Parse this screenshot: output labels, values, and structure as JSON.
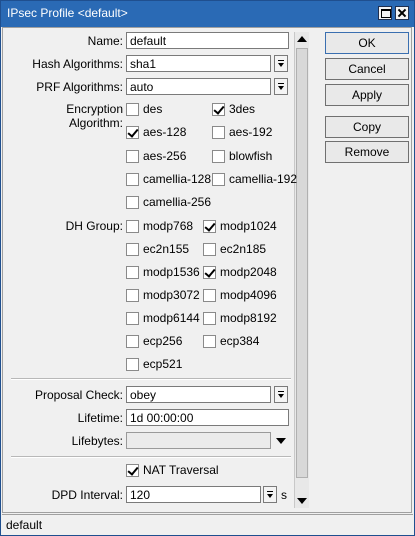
{
  "window": {
    "title": "IPsec Profile <default>"
  },
  "form": {
    "name_label": "Name:",
    "name_value": "default",
    "hash_label": "Hash Algorithms:",
    "hash_value": "sha1",
    "prf_label": "PRF Algorithms:",
    "prf_value": "auto",
    "enc_label": "Encryption Algorithm:",
    "enc_options": [
      {
        "label": "des",
        "checked": false
      },
      {
        "label": "3des",
        "checked": true
      },
      {
        "label": "aes-128",
        "checked": true
      },
      {
        "label": "aes-192",
        "checked": false
      },
      {
        "label": "aes-256",
        "checked": false
      },
      {
        "label": "blowfish",
        "checked": false
      },
      {
        "label": "camellia-128",
        "checked": false
      },
      {
        "label": "camellia-192",
        "checked": false
      },
      {
        "label": "camellia-256",
        "checked": false
      }
    ],
    "dh_label": "DH Group:",
    "dh_options": [
      {
        "label": "modp768",
        "checked": false
      },
      {
        "label": "modp1024",
        "checked": true
      },
      {
        "label": "ec2n155",
        "checked": false
      },
      {
        "label": "ec2n185",
        "checked": false
      },
      {
        "label": "modp1536",
        "checked": false
      },
      {
        "label": "modp2048",
        "checked": true
      },
      {
        "label": "modp3072",
        "checked": false
      },
      {
        "label": "modp4096",
        "checked": false
      },
      {
        "label": "modp6144",
        "checked": false
      },
      {
        "label": "modp8192",
        "checked": false
      },
      {
        "label": "ecp256",
        "checked": false
      },
      {
        "label": "ecp384",
        "checked": false
      },
      {
        "label": "ecp521",
        "checked": false
      }
    ],
    "proposal_label": "Proposal Check:",
    "proposal_value": "obey",
    "lifetime_label": "Lifetime:",
    "lifetime_value": "1d 00:00:00",
    "lifebytes_label": "Lifebytes:",
    "lifebytes_value": "",
    "nat_label": "NAT Traversal",
    "nat_checked": true,
    "dpd_label": "DPD Interval:",
    "dpd_value": "120",
    "dpd_unit": "s"
  },
  "buttons": {
    "ok": "OK",
    "cancel": "Cancel",
    "apply": "Apply",
    "copy": "Copy",
    "remove": "Remove"
  },
  "status": {
    "text": "default"
  }
}
